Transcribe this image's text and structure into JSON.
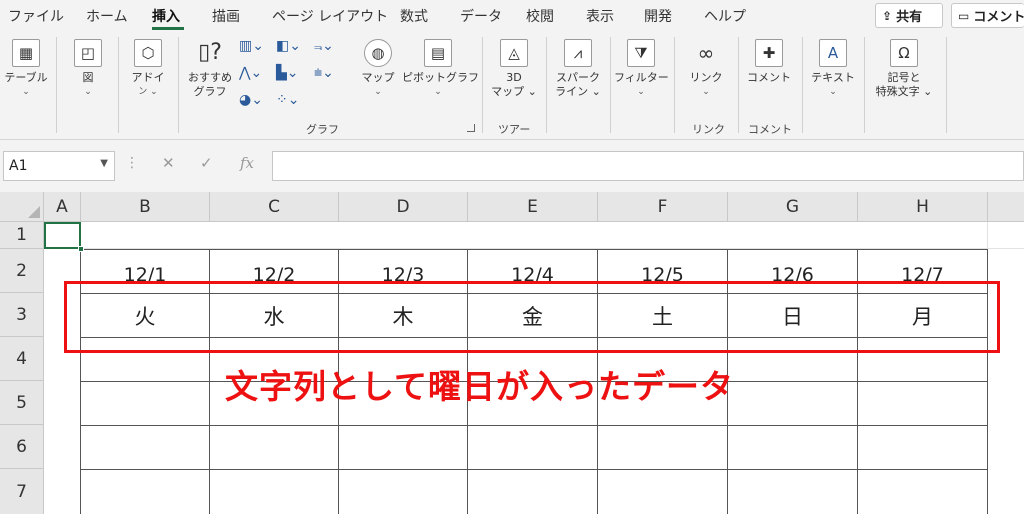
{
  "menu": {
    "tabs": [
      "ファイル",
      "ホーム",
      "挿入",
      "描画",
      "ページ レイアウト",
      "数式",
      "データ",
      "校閲",
      "表示",
      "開発",
      "ヘルプ"
    ],
    "share_label": "共有",
    "comment_label": "コメント"
  },
  "ribbon": {
    "table": {
      "l1": "テーブル",
      "l2": "⌄"
    },
    "figure": {
      "l1": "図",
      "l2": "⌄"
    },
    "addin": {
      "l1": "アドイ",
      "l2": "ン ⌄"
    },
    "recommended_chart": {
      "l1": "おすすめ",
      "l2": "グラフ"
    },
    "map": {
      "l1": "マップ",
      "l2": "⌄"
    },
    "pivot_chart": {
      "l1": "ピボットグラフ",
      "l2": "⌄"
    },
    "map3d": {
      "l1": "3D",
      "l2": "マップ ⌄"
    },
    "sparkline": {
      "l1": "スパーク",
      "l2": "ライン ⌄"
    },
    "filter": {
      "l1": "フィルター",
      "l2": "⌄"
    },
    "link": {
      "l1": "リンク",
      "l2": "⌄"
    },
    "comment": {
      "l1": "コメント"
    },
    "text": {
      "l1": "テキスト",
      "l2": "⌄"
    },
    "symbol": {
      "l1": "記号と",
      "l2": "特殊文字 ⌄"
    },
    "groups": {
      "graph": "グラフ",
      "tour": "ツアー",
      "link": "リンク",
      "comment": "コメント"
    }
  },
  "formula_bar": {
    "name_box": "A1",
    "fx": "fx"
  },
  "sheet": {
    "columns": [
      "A",
      "B",
      "C",
      "D",
      "E",
      "F",
      "G",
      "H"
    ],
    "rows": [
      "1",
      "2",
      "3",
      "4",
      "5",
      "6",
      "7"
    ],
    "dates": [
      "12/1",
      "12/2",
      "12/3",
      "12/4",
      "12/5",
      "12/6",
      "12/7"
    ],
    "days": [
      "火",
      "水",
      "木",
      "金",
      "土",
      "日",
      "月"
    ]
  },
  "annotation": "文字列として曜日が入ったデータ",
  "colors": {
    "accent": "#217346",
    "highlight": "#ee1111"
  }
}
